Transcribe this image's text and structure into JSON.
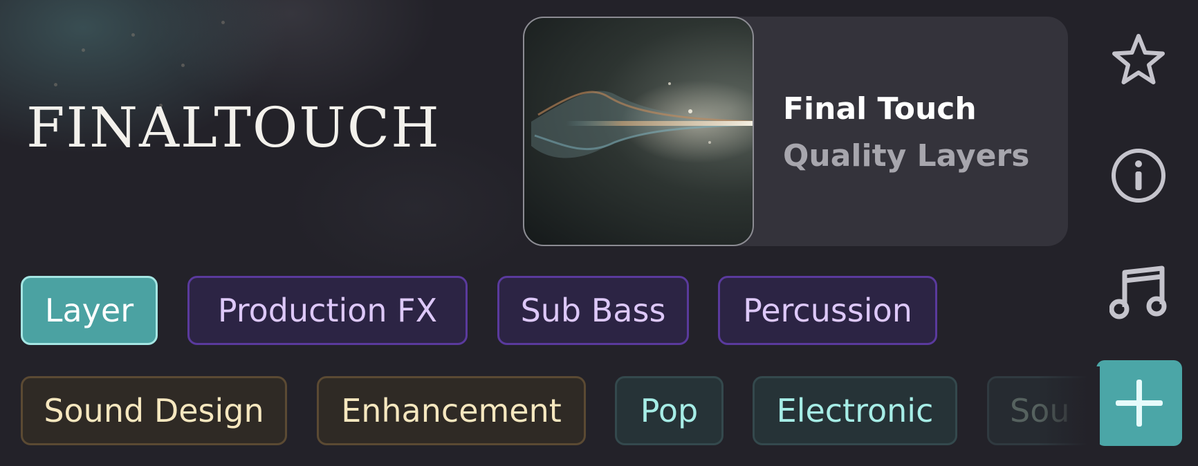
{
  "logo": {
    "text": "FINALTOUCH"
  },
  "pack": {
    "title": "Final Touch",
    "subtitle": "Quality Layers"
  },
  "sidebar": {
    "icons": [
      "star-icon",
      "info-icon",
      "music-note-icon",
      "plus-icon"
    ]
  },
  "tags_row1": [
    {
      "label": "Layer",
      "style": "teal-active"
    },
    {
      "label": "Production FX",
      "style": "purple"
    },
    {
      "label": "Sub Bass",
      "style": "purple"
    },
    {
      "label": "Percussion",
      "style": "purple"
    }
  ],
  "tags_row2": [
    {
      "label": "Sound Design",
      "style": "amber"
    },
    {
      "label": "Enhancement",
      "style": "amber"
    },
    {
      "label": "Pop",
      "style": "teal"
    },
    {
      "label": "Electronic",
      "style": "teal"
    },
    {
      "label": "Sou",
      "style": "faded"
    }
  ],
  "colors": {
    "background": "#232229",
    "card": "#34333b",
    "accent_teal": "#4ba6a7",
    "purple_border": "#5a3a9d",
    "amber_border": "#5b4a33"
  }
}
